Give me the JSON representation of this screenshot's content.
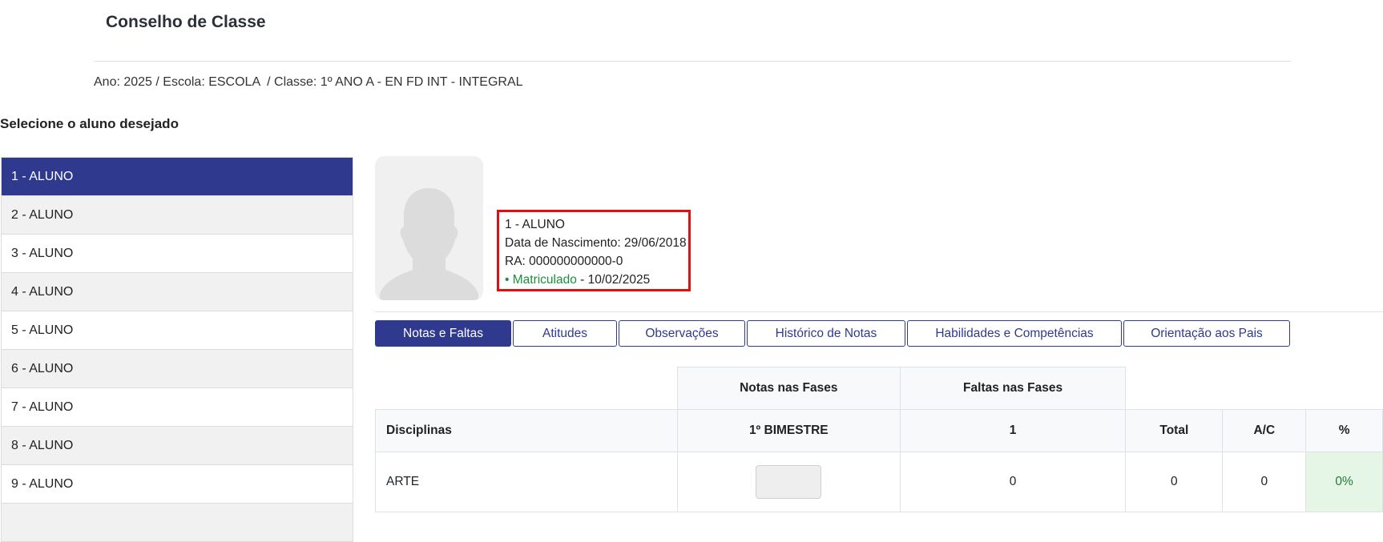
{
  "page_title": "Conselho de Classe",
  "breadcrumb": "Ano: 2025 / Escola: ESCOLA  / Classe: 1º ANO A - EN FD INT - INTEGRAL",
  "select_label": "Selecione o aluno desejado",
  "students": [
    "1 - ALUNO",
    "2 - ALUNO",
    "3 - ALUNO",
    "4 - ALUNO",
    "5 - ALUNO",
    "6 - ALUNO",
    "7 - ALUNO",
    "8 - ALUNO",
    "9 - ALUNO",
    ""
  ],
  "selected_student_index": 0,
  "student_info": {
    "name": "1 - ALUNO",
    "birth": "Data de Nascimento: 29/06/2018",
    "ra": "RA: 000000000000-0",
    "status": "• Matriculado",
    "status_date": " - 10/02/2025"
  },
  "photo_icon": "person-silhouette-icon",
  "tabs": [
    "Notas e Faltas",
    "Atitudes",
    "Observações",
    "Histórico de Notas",
    "Habilidades e Competências",
    "Orientação aos Pais"
  ],
  "active_tab_index": 0,
  "table": {
    "group_notas": "Notas nas Fases",
    "group_faltas": "Faltas nas Fases",
    "col_disciplinas": "Disciplinas",
    "col_bimestre": "1º BIMESTRE",
    "col_fase": "1",
    "col_total": "Total",
    "col_ac": "A/C",
    "col_pct": "%",
    "rows": [
      {
        "disciplina": "ARTE",
        "nota": "",
        "faltas": "0",
        "total": "0",
        "ac": "0",
        "pct": "0%"
      }
    ]
  },
  "colors": {
    "primary": "#2f3a8f",
    "highlight": "#e01010",
    "status_green": "#1e8e3e"
  }
}
